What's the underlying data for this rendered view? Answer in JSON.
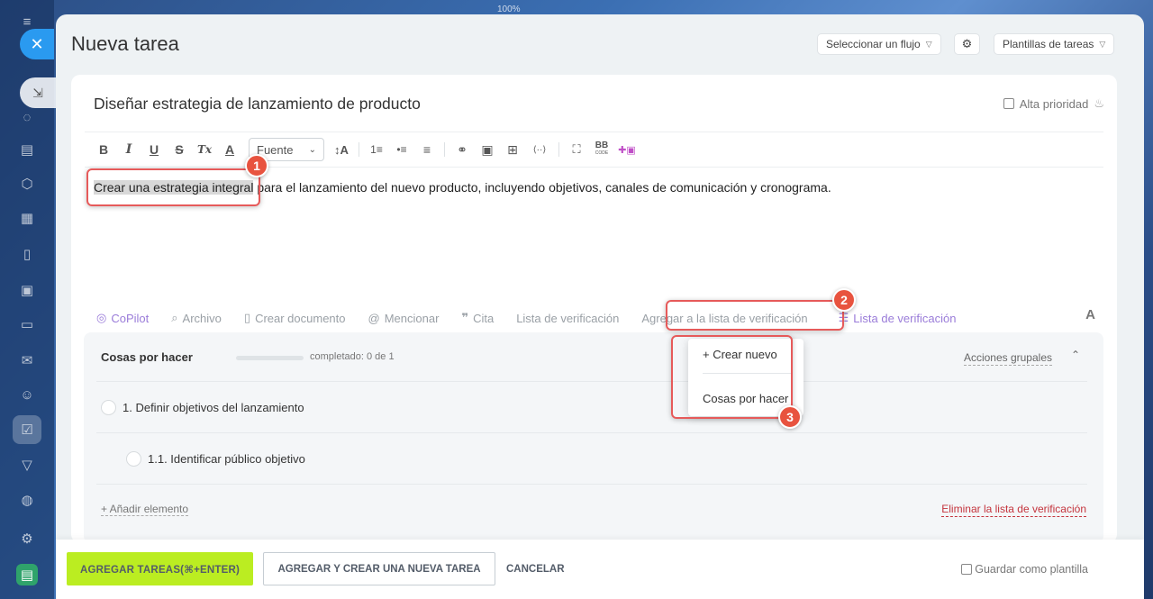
{
  "window": {
    "zoom": "100%"
  },
  "header": {
    "title": "Nueva tarea",
    "flow_button": "Seleccionar un flujo",
    "templates_button": "Plantillas de tareas"
  },
  "task": {
    "title": "Diseñar estrategia de lanzamiento de producto",
    "priority_label": "Alta prioridad",
    "editor": {
      "font_select": "Fuente",
      "highlighted_text": "Crear una estrategia integral",
      "rest_text": " para el lanzamiento del nuevo producto, incluyendo objetivos, canales de comunicación y cronograma."
    }
  },
  "toolbar": {
    "bold": "B",
    "italic": "I",
    "underline": "U",
    "strike": "S",
    "clear_format": "Tx",
    "text_color": "A",
    "font_size": "↕A",
    "ordered_list": "1≡",
    "bulleted_list": "•≡",
    "align": "≡",
    "link": "⚭",
    "image": "▣",
    "table": "⊞",
    "code": "⟨··⟩",
    "fullscreen": "⛶",
    "bbcode_top": "BB",
    "bbcode_bottom": "CODE",
    "add_image": "✚▣"
  },
  "editor_tools": {
    "copilot": "CoPilot",
    "file": "Archivo",
    "create_doc": "Crear documento",
    "mention": "Mencionar",
    "quote": "Cita",
    "checklist": "Lista de verificación",
    "add_to_checklist": "Agregar a la lista de verificación",
    "checklist_purple": "Lista de verificación",
    "font_toggle": "A"
  },
  "checklist": {
    "title": "Cosas por hacer",
    "progress_text": "completado: 0 de 1",
    "progress_fraction": 0,
    "group_actions": "Acciones grupales",
    "items": [
      {
        "label": "1. Definir objetivos del lanzamiento"
      },
      {
        "label": "1.1. Identificar público objetivo"
      }
    ],
    "add_item": "+ Añadir elemento",
    "delete_list": "Eliminar la lista de verificación"
  },
  "dropdown": {
    "create_new": "+ Crear nuevo",
    "existing": "Cosas por hacer"
  },
  "annotations": {
    "one": "1",
    "two": "2",
    "three": "3"
  },
  "footer": {
    "primary": "AGREGAR TAREAS(⌘+ENTER)",
    "secondary": "AGREGAR Y CREAR UNA NUEVA TAREA",
    "cancel": "CANCELAR",
    "save_template": "Guardar como plantilla"
  },
  "colors": {
    "primary_button": "#bbed21",
    "annotation_red": "#e65a5a",
    "danger_link": "#c4343d",
    "copilot_purple": "#9a7cd9"
  }
}
